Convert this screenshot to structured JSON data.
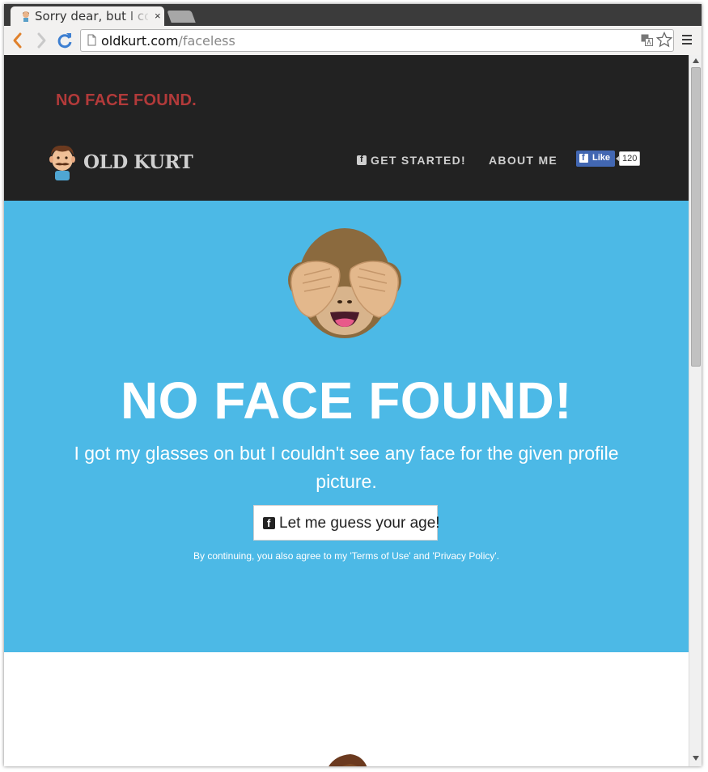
{
  "browser": {
    "tab_title": "Sorry dear, but I couldn't see",
    "close_glyph": "×",
    "url_host": "oldkurt.com",
    "url_path": "/faceless"
  },
  "site": {
    "alert_text": "NO FACE FOUND.",
    "brand": "OLD KURT",
    "nav": {
      "get_started": "GET STARTED!",
      "about_me": "ABOUT ME"
    },
    "fb_like": {
      "label": "Like",
      "count": "120"
    }
  },
  "hero": {
    "title": "NO FACE FOUND!",
    "subtitle": "I got my glasses on but I couldn't see any face for the given profile picture.",
    "cta_label": "Let me guess your age!",
    "terms_prefix": "By continuing, you also agree to my ",
    "terms_of_use": "'Terms of Use'",
    "terms_and": " and ",
    "privacy_policy": "'Privacy Policy'",
    "terms_suffix": "."
  },
  "colors": {
    "header_bg": "#222222",
    "alert": "#b23a3a",
    "hero_bg": "#4cb9e6",
    "fb_blue": "#4267b2"
  }
}
